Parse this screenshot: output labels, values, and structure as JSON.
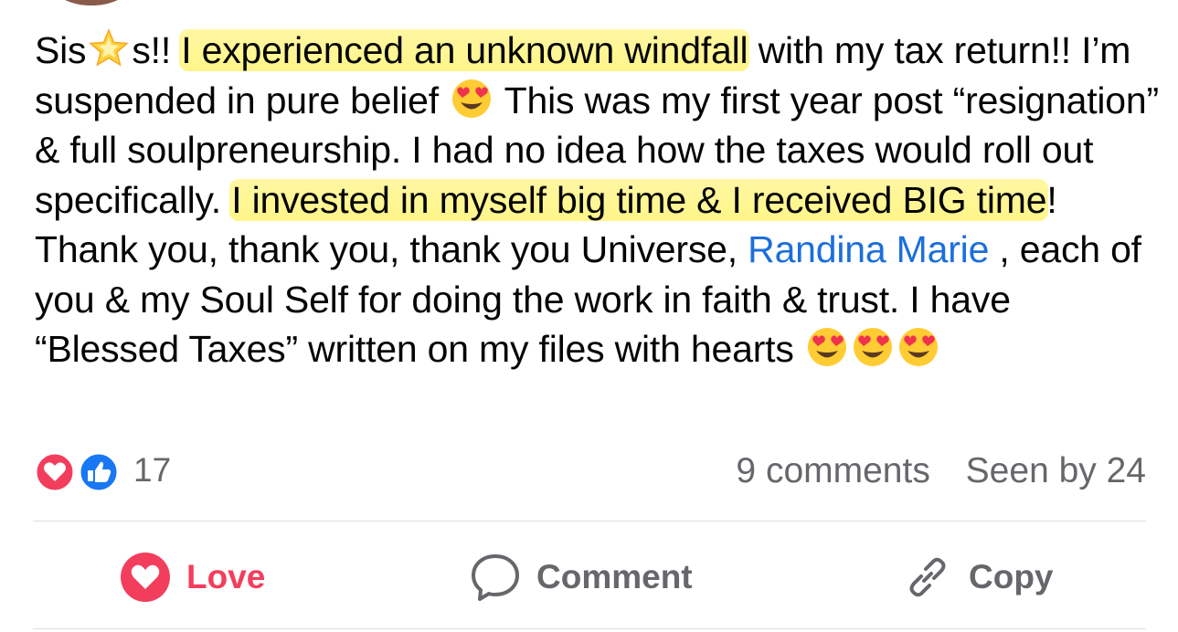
{
  "post": {
    "segments": [
      {
        "type": "text",
        "text": "Sis"
      },
      {
        "type": "emoji",
        "name": "glowing-star-icon"
      },
      {
        "type": "text",
        "text": "s!! "
      },
      {
        "type": "highlight",
        "text": "I experienced an unknown windfall"
      },
      {
        "type": "text",
        "text": " with my tax return!! I’m suspended in pure belief "
      },
      {
        "type": "emoji",
        "name": "heart-eyes-emoji-icon"
      },
      {
        "type": "text",
        "text": " This was my first year post “resignation” & full soulpreneurship. I had no idea how the taxes would roll out specifically. "
      },
      {
        "type": "highlight",
        "text": "I invested in myself big time & I received BIG time"
      },
      {
        "type": "text",
        "text": "! Thank you, thank you, thank you Universe, "
      },
      {
        "type": "mention",
        "text": "Randina Marie"
      },
      {
        "type": "text",
        "text": " , each of you & my Soul Self for doing the work in faith & trust. I have “Blessed Taxes” written on my files with hearts "
      },
      {
        "type": "emoji",
        "name": "heart-eyes-emoji-icon"
      },
      {
        "type": "emoji",
        "name": "heart-eyes-emoji-icon"
      },
      {
        "type": "emoji",
        "name": "heart-eyes-emoji-icon"
      }
    ]
  },
  "stats": {
    "reaction_icons": [
      "love-reaction-icon",
      "like-reaction-icon"
    ],
    "reaction_count": "17",
    "comments": "9 comments",
    "seen_by": "Seen by 24"
  },
  "actions": {
    "love_label": "Love",
    "comment_label": "Comment",
    "copy_label": "Copy"
  },
  "colors": {
    "highlight": "#fff589",
    "mention": "#1b6fdb",
    "love": "#f23e5c",
    "like": "#1877f2",
    "muted": "#65676b"
  }
}
